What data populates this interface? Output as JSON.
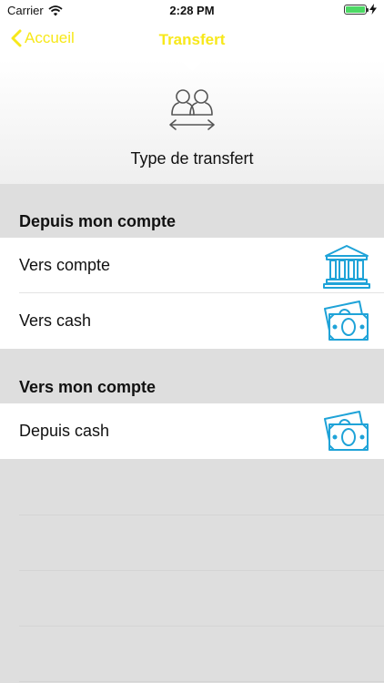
{
  "status_bar": {
    "carrier": "Carrier",
    "time": "2:28 PM",
    "battery_level": 1.0
  },
  "nav_bar": {
    "back_label": "Accueil",
    "title": "Transfert",
    "accent_color": "#f7e81a"
  },
  "header": {
    "icon": "transfer-users-icon",
    "label": "Type de transfert"
  },
  "sections": [
    {
      "title": "Depuis mon compte",
      "items": [
        {
          "label": "Vers compte",
          "icon": "bank-icon"
        },
        {
          "label": "Vers cash",
          "icon": "cash-icon"
        }
      ]
    },
    {
      "title": "Vers mon compte",
      "items": [
        {
          "label": "Depuis cash",
          "icon": "cash-icon"
        }
      ]
    }
  ],
  "icon_color": "#1fa3d8"
}
